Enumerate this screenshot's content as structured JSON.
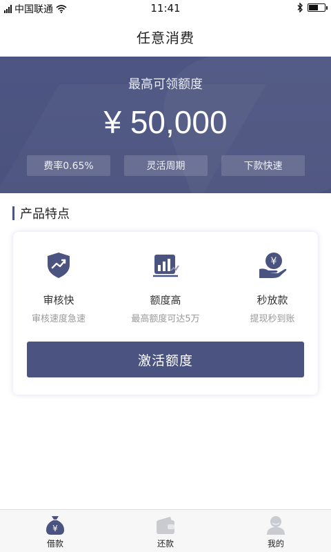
{
  "status_bar": {
    "carrier": "中国联通",
    "time": "11:41",
    "battery_level": 0.6
  },
  "nav": {
    "title": "任意消费"
  },
  "hero": {
    "label": "最高可领额度",
    "amount": "¥ 50,000",
    "tags": [
      "费率0.65%",
      "灵活周期",
      "下款快速"
    ]
  },
  "section": {
    "title": "产品特点"
  },
  "features": [
    {
      "icon": "shield-check-icon",
      "title": "审核快",
      "subtitle": "审核速度急速"
    },
    {
      "icon": "bar-chart-icon",
      "title": "额度高",
      "subtitle": "最高额度可达5万"
    },
    {
      "icon": "yen-hand-icon",
      "title": "秒放款",
      "subtitle": "提现秒到账"
    }
  ],
  "cta": {
    "label": "激活额度"
  },
  "tabbar": {
    "items": [
      {
        "icon": "money-bag-icon",
        "label": "借款",
        "active": true
      },
      {
        "icon": "wallet-icon",
        "label": "还款",
        "active": false
      },
      {
        "icon": "user-icon",
        "label": "我的",
        "active": false
      }
    ]
  },
  "colors": {
    "primary": "#4b5381",
    "hero_bg": "#4d5682",
    "inactive_icon": "#c9cbd1"
  }
}
